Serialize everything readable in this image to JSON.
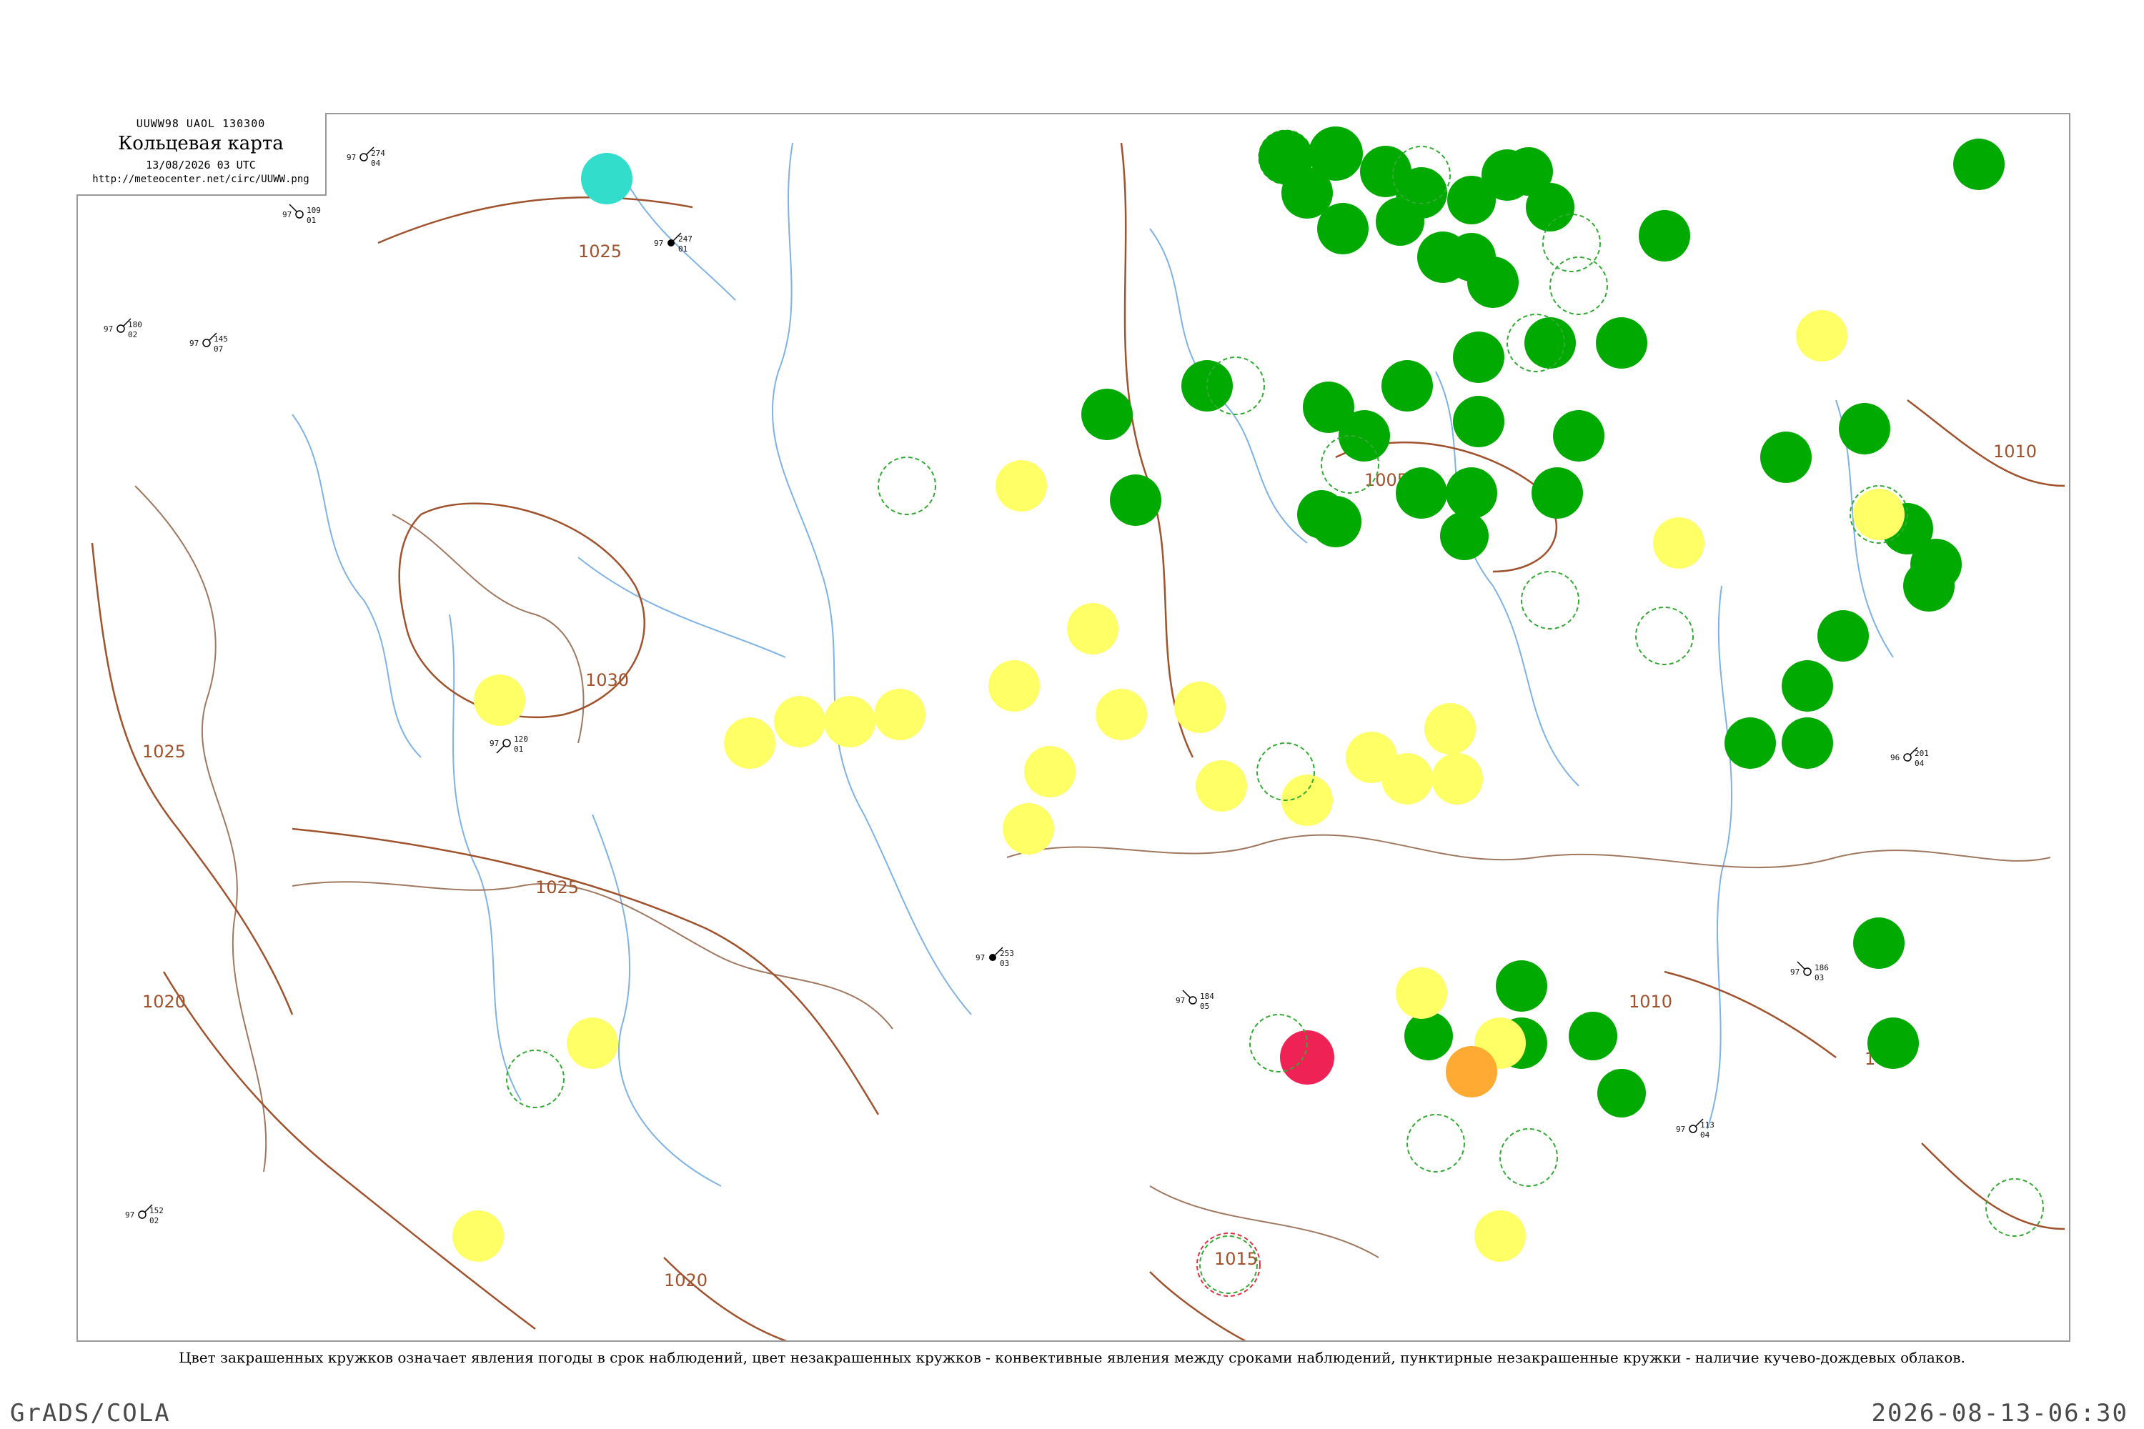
{
  "header": {
    "code": "UUWW98  UAOL  130300",
    "title": "Кольцевая карта",
    "time": "13/08/2026 03 UTC",
    "url": "http://meteocenter.net/circ/UUWW.png"
  },
  "caption": "Цвет закрашенных кружков означает явления погоды в срок наблюдений, цвет незакрашенных кружков - конвективные явления между сроками наблюдений, пунктирные незакрашенные кружки - наличие кучево-дождевых облаков.",
  "footer": {
    "left": "GrADS/COLA",
    "right": "2026-08-13-06:30"
  },
  "isobar_labels": [
    {
      "text": "1025",
      "color": "#a0522d"
    },
    {
      "text": "1030",
      "color": "#a0522d"
    },
    {
      "text": "1025",
      "color": "#a0522d"
    },
    {
      "text": "1025",
      "color": "#a0522d"
    },
    {
      "text": "1020",
      "color": "#a0522d"
    },
    {
      "text": "1020",
      "color": "#a0522d"
    },
    {
      "text": "1015",
      "color": "#a0522d"
    },
    {
      "text": "1010",
      "color": "#a0522d"
    },
    {
      "text": "1010",
      "color": "#a0522d"
    },
    {
      "text": "1010",
      "color": "#a0522d"
    },
    {
      "text": "1005",
      "color": "#a0522d"
    }
  ],
  "legend_colors": {
    "rain": "#00aa00",
    "fog_haze": "#ffff66",
    "thunder_orange": "#ffaa33",
    "storm_red": "#ee2255",
    "shower_cyan": "#33ddcc",
    "cb_dashed": "#33aa33",
    "isobar": "#a0522d",
    "river": "#7fb2e5"
  },
  "station_samples": [
    {
      "t": "274",
      "d": "04",
      "p": "97"
    },
    {
      "t": "247",
      "d": "01",
      "p": "97"
    },
    {
      "t": "109",
      "d": "01",
      "p": "97"
    },
    {
      "t": "120",
      "d": "01",
      "p": "97"
    },
    {
      "t": "145",
      "d": "07",
      "p": "97"
    },
    {
      "t": "152",
      "d": "02",
      "p": "97"
    },
    {
      "t": "180",
      "d": "02",
      "p": "97"
    },
    {
      "t": "253",
      "d": "03",
      "p": "97"
    },
    {
      "t": "184",
      "d": "05",
      "p": "97"
    },
    {
      "t": "113",
      "d": "04",
      "p": "97"
    },
    {
      "t": "201",
      "d": "04",
      "p": "96"
    },
    {
      "t": "186",
      "d": "03",
      "p": "97"
    }
  ]
}
